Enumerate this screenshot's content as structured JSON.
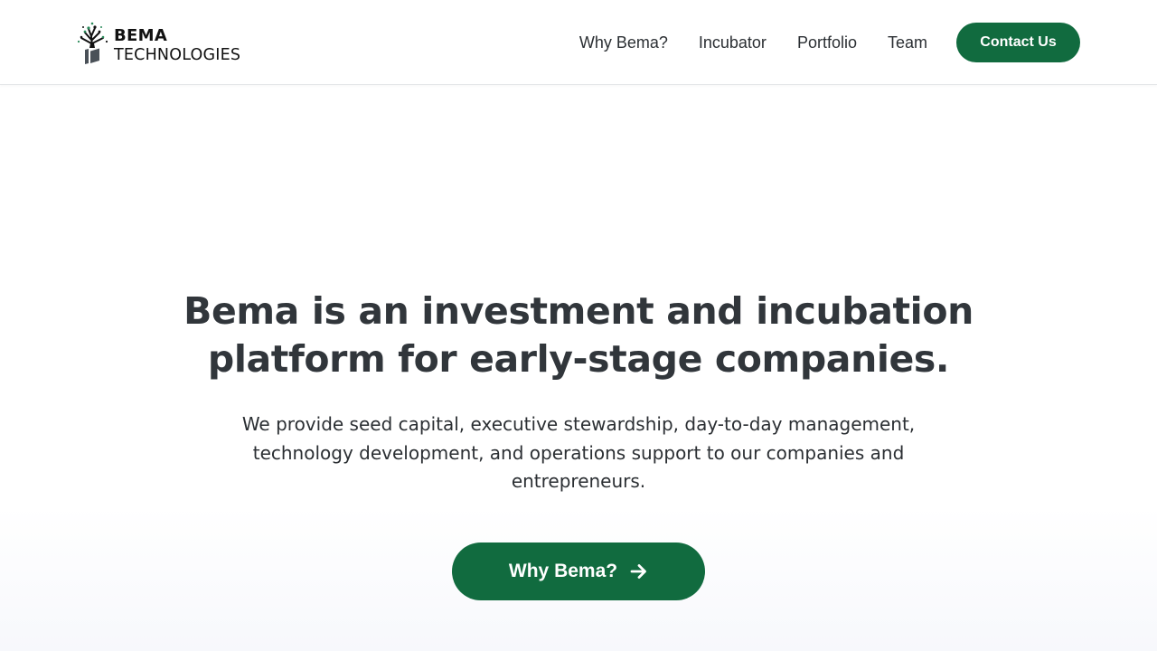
{
  "brand": {
    "name_top": "BEMA",
    "name_bottom": "TECHNOLOGIES",
    "logo_icon": "tree-logo-icon",
    "accent_color": "#116b3f"
  },
  "nav": {
    "links": [
      "Why Bema?",
      "Incubator",
      "Portfolio",
      "Team"
    ],
    "cta_label": "Contact Us"
  },
  "hero": {
    "title": "Bema is an investment and incubation platform for early-stage companies.",
    "subtitle": "We provide seed capital, executive stewardship, day-to-day management, technology development, and operations support to our companies and entrepreneurs.",
    "button_label": "Why Bema?",
    "button_icon": "arrow-right-icon"
  }
}
